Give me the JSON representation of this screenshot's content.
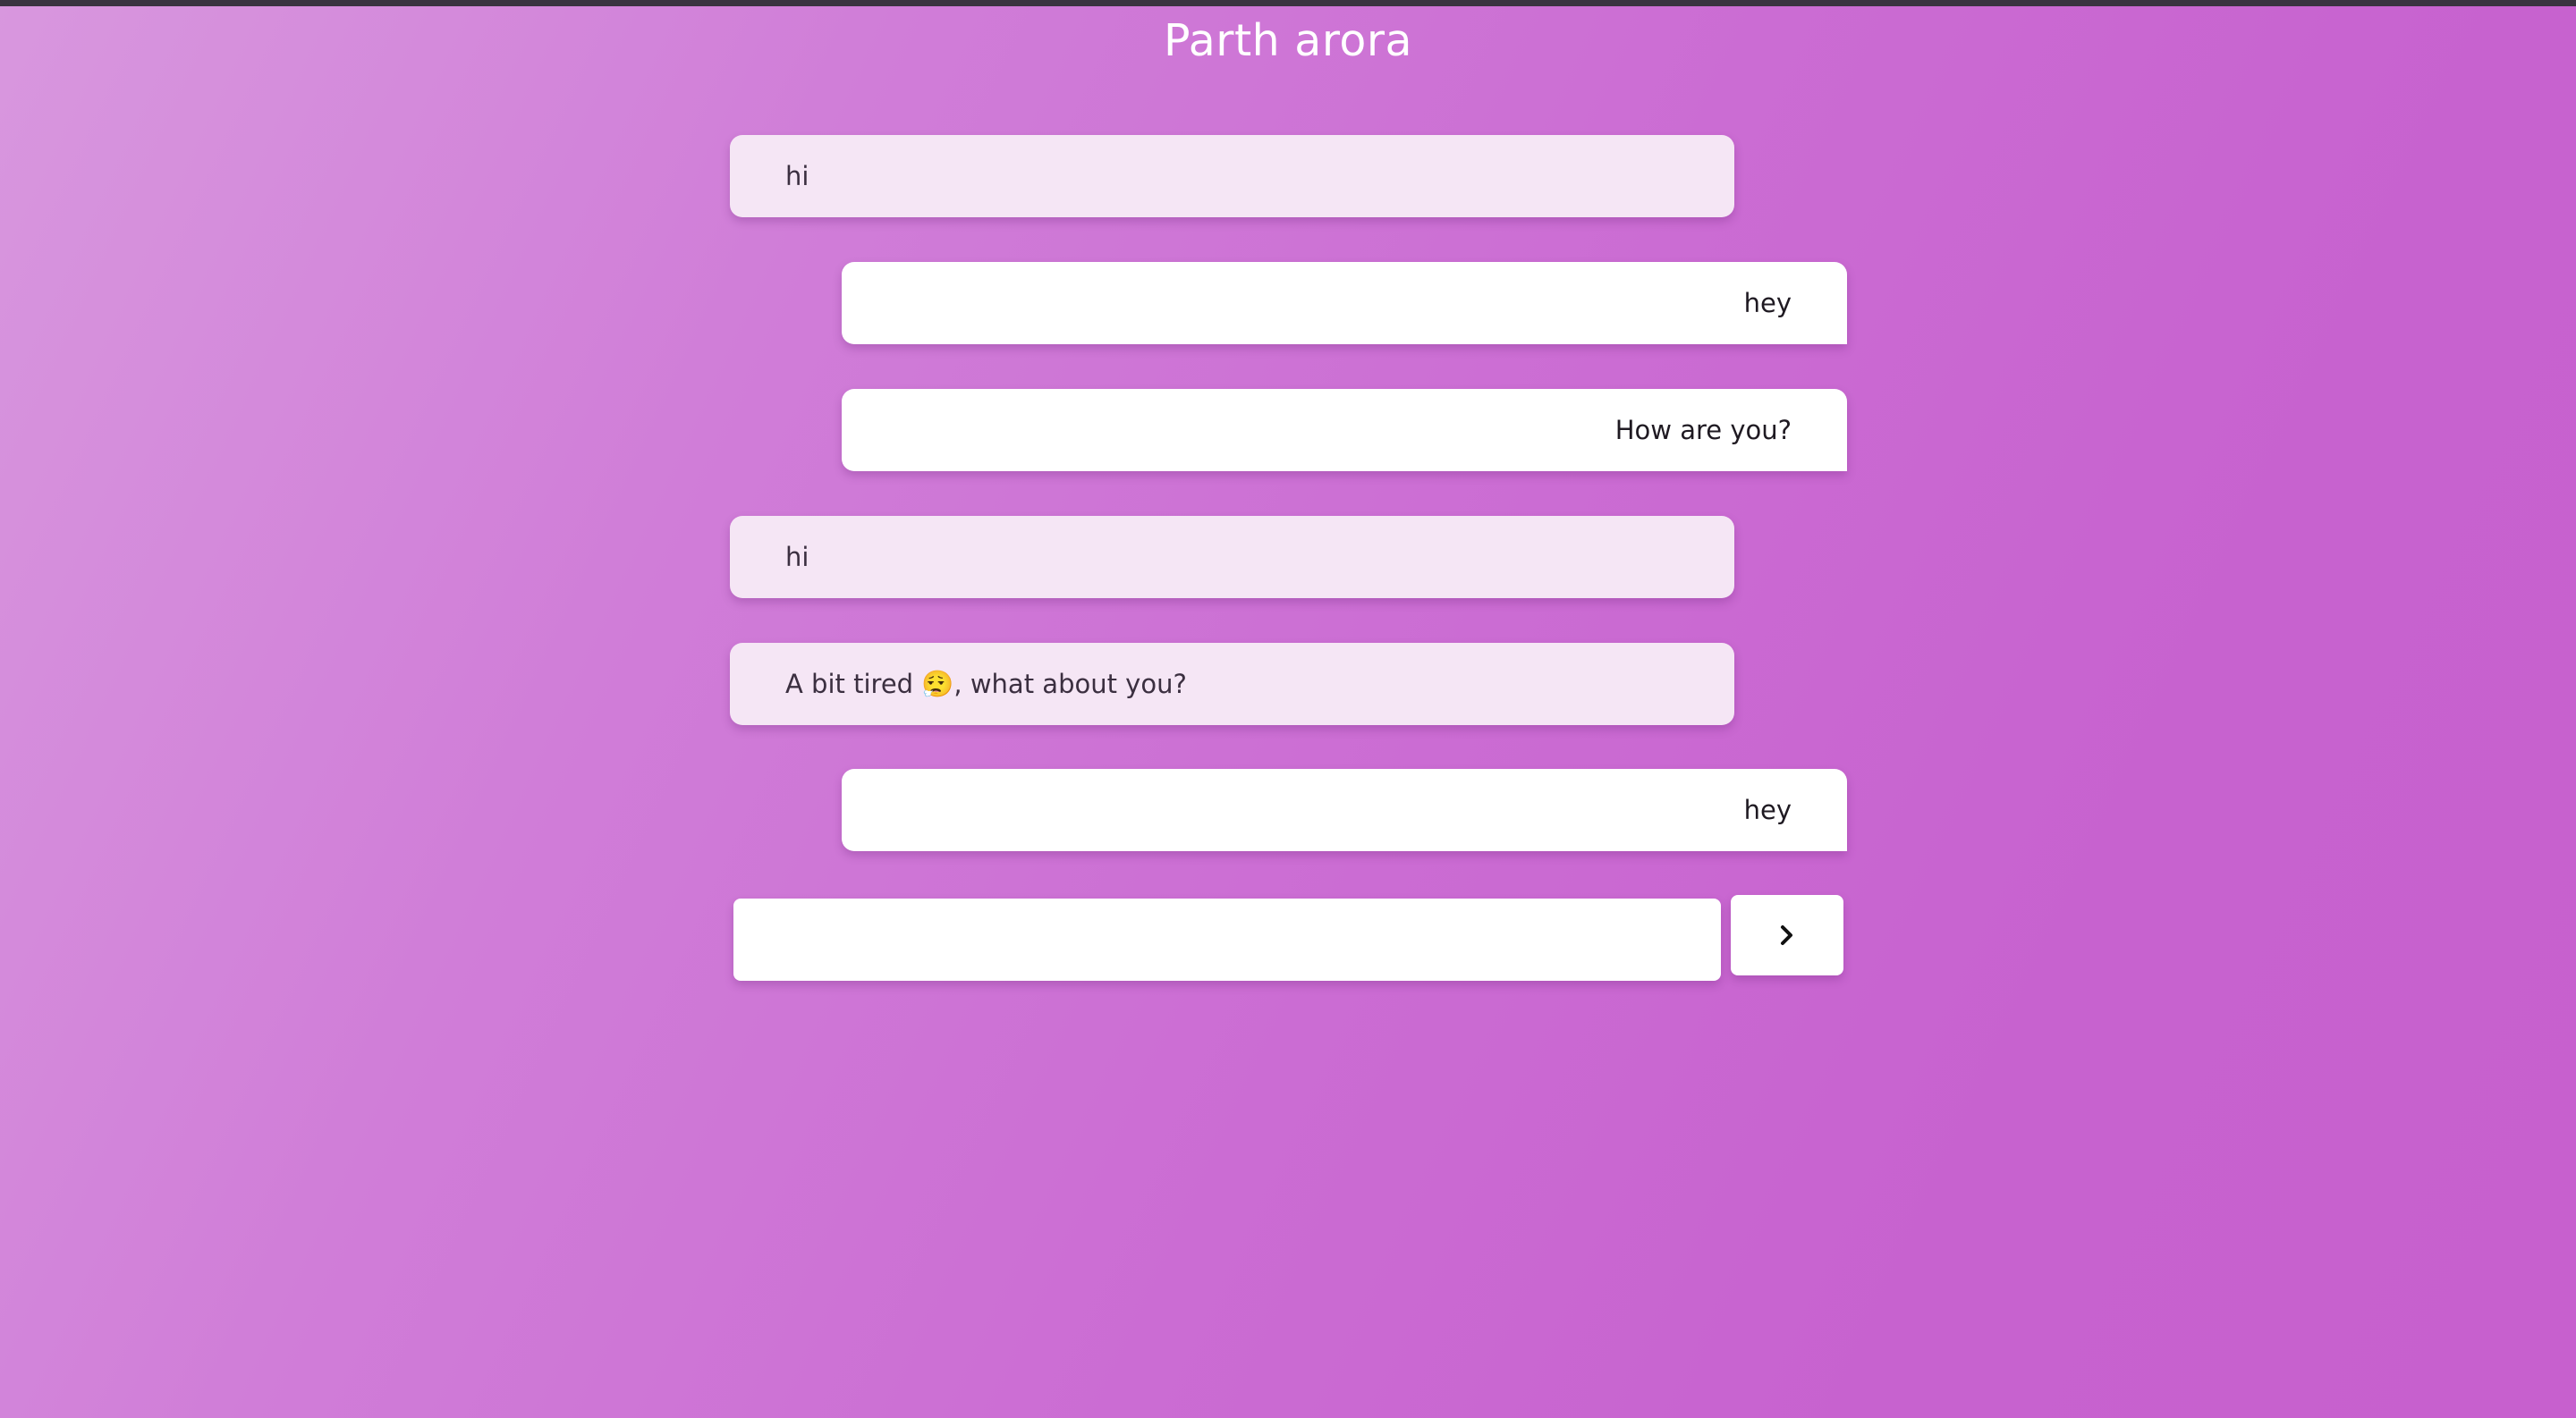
{
  "header": {
    "title": "Parth arora"
  },
  "messages": [
    {
      "direction": "incoming",
      "text": "hi"
    },
    {
      "direction": "outgoing",
      "text": "hey"
    },
    {
      "direction": "outgoing",
      "text": "How are you?"
    },
    {
      "direction": "incoming",
      "text": "hi"
    },
    {
      "direction": "incoming",
      "text": "A bit tired 😮‍💨, what about you?"
    },
    {
      "direction": "outgoing",
      "text": "hey"
    }
  ],
  "composer": {
    "value": "",
    "placeholder": "",
    "send_icon": "chevron-right-icon"
  },
  "colors": {
    "background_start": "#d897de",
    "background_end": "#c760ce",
    "incoming_bubble": "#f5e6f5",
    "outgoing_bubble": "#ffffff",
    "title": "#ffffff"
  }
}
